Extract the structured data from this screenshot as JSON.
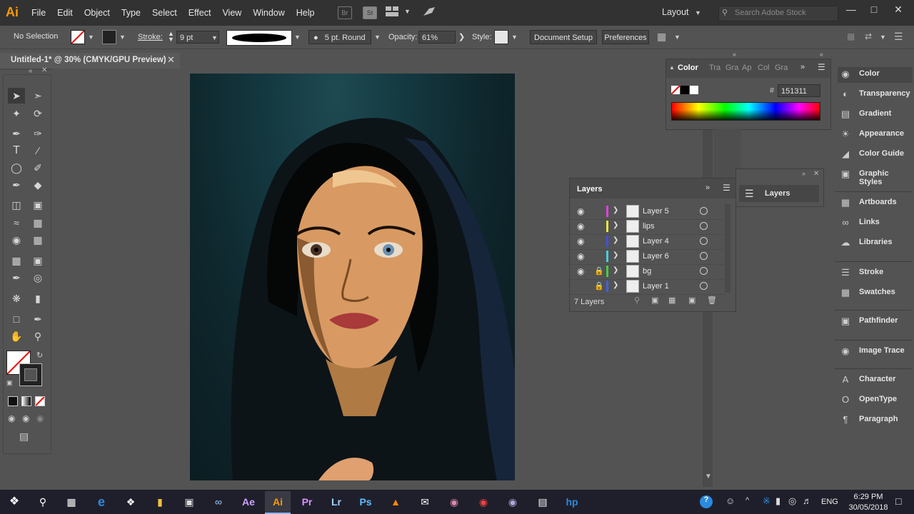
{
  "menubar": {
    "logo": "Ai",
    "items": [
      "File",
      "Edit",
      "Object",
      "Type",
      "Select",
      "Effect",
      "View",
      "Window",
      "Help"
    ],
    "badges": [
      "Br",
      "St"
    ],
    "workspace": "Layout",
    "search_placeholder": "Search Adobe Stock"
  },
  "control": {
    "selection": "No Selection",
    "stroke_label": "Stroke:",
    "stroke_value": "9 pt",
    "brush_label": "5 pt. Round",
    "opacity_label": "Opacity:",
    "opacity_value": "61%",
    "style_label": "Style:",
    "document_setup": "Document Setup",
    "preferences": "Preferences"
  },
  "document": {
    "tab_title": "Untitled-1* @ 30% (CMYK/GPU Preview)"
  },
  "color_panel": {
    "tabs": [
      "Color",
      "Tra",
      "Gra",
      "Ap",
      "Col",
      "Gra"
    ],
    "hex_label": "#",
    "hex_value": "151311"
  },
  "layers_panel": {
    "title": "Layers",
    "layers": [
      {
        "name": "Layer 5",
        "color": "#e040e0",
        "visible": true,
        "locked": false
      },
      {
        "name": "lips",
        "color": "#e6e640",
        "visible": true,
        "locked": false
      },
      {
        "name": "Layer 4",
        "color": "#4050e0",
        "visible": true,
        "locked": false
      },
      {
        "name": "Layer 6",
        "color": "#40d0e0",
        "visible": true,
        "locked": false
      },
      {
        "name": "bg",
        "color": "#40d040",
        "visible": true,
        "locked": true
      },
      {
        "name": "Layer 1",
        "color": "#4060e0",
        "visible": false,
        "locked": true
      }
    ],
    "count": "7 Layers"
  },
  "mini_layers": {
    "label": "Layers"
  },
  "dock": {
    "group1": [
      "Color",
      "Transparency",
      "Gradient",
      "Appearance",
      "Color Guide",
      "Graphic Styles"
    ],
    "group2": [
      "Artboards",
      "Links",
      "Libraries"
    ],
    "group3": [
      "Stroke",
      "Swatches"
    ],
    "group4": [
      "Pathfinder"
    ],
    "group5": [
      "Image Trace"
    ],
    "group6": [
      "Character",
      "OpenType",
      "Paragraph"
    ]
  },
  "taskbar": {
    "lang": "ENG",
    "time": "6:29 PM",
    "date": "30/05/2018",
    "apps": [
      "Ae",
      "Ai",
      "Pr",
      "Lr",
      "Ps"
    ]
  }
}
